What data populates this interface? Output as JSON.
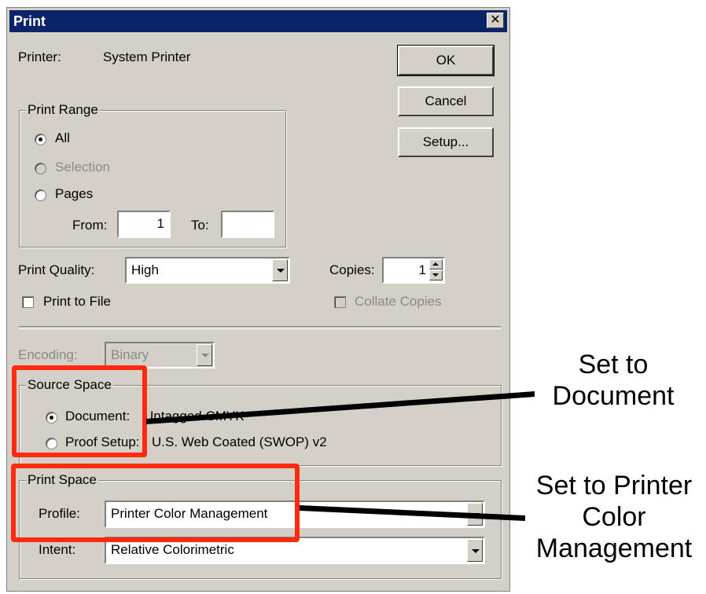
{
  "dialog": {
    "title": "Print",
    "close_glyph": "✕",
    "printer_label": "Printer:",
    "printer_value": "System Printer",
    "buttons": {
      "ok": "OK",
      "cancel": "Cancel",
      "setup": "Setup..."
    },
    "print_range": {
      "title": "Print Range",
      "all": "All",
      "selection": "Selection",
      "pages": "Pages",
      "from_label": "From:",
      "from_value": "1",
      "to_label": "To:",
      "to_value": ""
    },
    "print_quality": {
      "label": "Print Quality:",
      "value": "High"
    },
    "copies": {
      "label": "Copies:",
      "value": "1"
    },
    "print_to_file": "Print to File",
    "collate": "Collate Copies",
    "encoding": {
      "label": "Encoding:",
      "value": "Binary"
    },
    "source_space": {
      "title": "Source Space",
      "document_label": "Document:",
      "document_value": "Untagged CMYK",
      "proof_label": "Proof Setup:",
      "proof_value": "U.S. Web Coated (SWOP) v2"
    },
    "print_space": {
      "title": "Print Space",
      "profile_label": "Profile:",
      "profile_value": "Printer Color Management",
      "intent_label": "Intent:",
      "intent_value": "Relative Colorimetric"
    }
  },
  "annotations": {
    "source_note_line1": "Set to",
    "source_note_line2": "Document",
    "print_note_line1": "Set to Printer",
    "print_note_line2": "Color",
    "print_note_line3": "Management"
  },
  "colors": {
    "highlight": "#ff2a10",
    "titlebar": "#0a246a",
    "dialog_bg": "#d4d0c8"
  }
}
